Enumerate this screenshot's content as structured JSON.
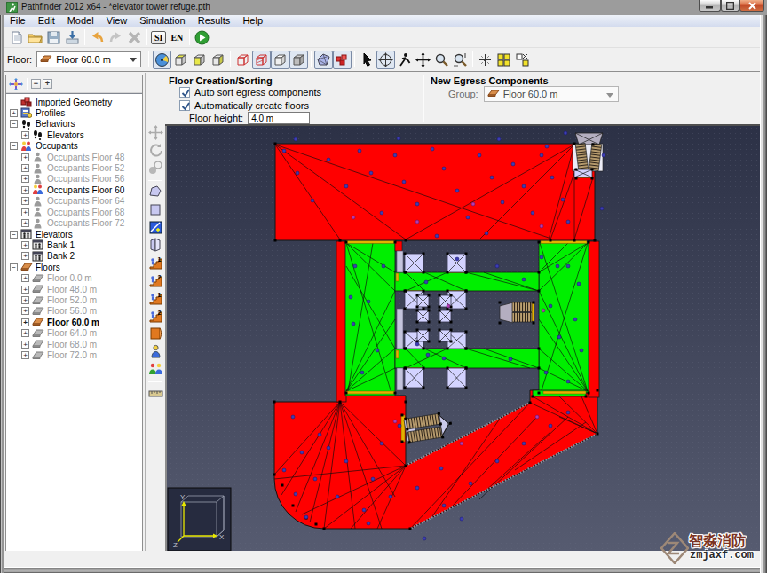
{
  "window": {
    "title": "Pathfinder 2012 x64 - *elevator tower refuge.pth",
    "buttons": [
      "minimize",
      "maximize",
      "close"
    ]
  },
  "menu": {
    "items": [
      "File",
      "Edit",
      "Model",
      "View",
      "Simulation",
      "Results",
      "Help"
    ]
  },
  "toolbar_main": {
    "items": [
      {
        "icon": "new-document"
      },
      {
        "icon": "open-folder"
      },
      {
        "icon": "save"
      },
      {
        "icon": "import"
      },
      {
        "sep": true
      },
      {
        "icon": "undo"
      },
      {
        "icon": "redo",
        "disabled": true
      },
      {
        "icon": "delete-x",
        "disabled": true
      },
      {
        "sep": true
      },
      {
        "icon": "si-units",
        "label": "SI",
        "boxed": true
      },
      {
        "icon": "en-language",
        "label": "EN"
      },
      {
        "sep": true
      },
      {
        "icon": "run-simulation"
      }
    ]
  },
  "floor_bar": {
    "label": "Floor:",
    "value": "Floor 60.0 m"
  },
  "view_toolbar": {
    "items": [
      {
        "icon": "perspective-view",
        "pressed": true
      },
      {
        "icon": "cube-top-view"
      },
      {
        "icon": "cube-front-view"
      },
      {
        "icon": "cube-side-view"
      },
      {
        "sep": true
      },
      {
        "icon": "wire-cube"
      },
      {
        "icon": "hatch-cube",
        "pressed": true
      },
      {
        "icon": "solid-cube",
        "pressed": true
      },
      {
        "icon": "gray-cube",
        "pressed": true
      },
      {
        "sep": true
      },
      {
        "icon": "show-navmesh",
        "pressed": true
      },
      {
        "icon": "show-results",
        "pressed": true
      },
      {
        "sep": true
      },
      {
        "icon": "select-arrow"
      },
      {
        "icon": "orbit-tool",
        "pressed": true
      },
      {
        "icon": "runner"
      },
      {
        "icon": "pan-tool"
      },
      {
        "icon": "zoom-tool"
      },
      {
        "icon": "zoom-box-tool"
      },
      {
        "sep": true
      },
      {
        "icon": "center-view"
      },
      {
        "icon": "view-all"
      },
      {
        "icon": "view-selection"
      }
    ]
  },
  "draw_toolbar": {
    "items": [
      {
        "icon": "move-tool",
        "disabled": true
      },
      {
        "icon": "rotate-tool",
        "disabled": true
      },
      {
        "icon": "scale-tool",
        "disabled": true
      },
      {
        "sep": true
      },
      {
        "icon": "polygon-room-tool"
      },
      {
        "icon": "rectangle-room-tool"
      },
      {
        "icon": "thin-room-tool"
      },
      {
        "icon": "door-tool"
      },
      {
        "icon": "stairs-up-tool",
        "badge": "1"
      },
      {
        "icon": "stairs-down-tool",
        "badge": "2"
      },
      {
        "icon": "ramp-up-tool",
        "badge": "1"
      },
      {
        "icon": "ramp-down-tool",
        "badge": "2"
      },
      {
        "icon": "doorway-tool"
      },
      {
        "icon": "occupant-tool"
      },
      {
        "icon": "occupant-group-tool"
      },
      {
        "sep": true
      },
      {
        "icon": "measure-tool"
      }
    ]
  },
  "tree_header": {
    "icons": [
      "refresh-colors",
      "collapse-all",
      "expand-all"
    ]
  },
  "tree": {
    "items": [
      {
        "label": "Imported Geometry",
        "icon": "geometry",
        "depth": 0,
        "exp": "none"
      },
      {
        "label": "Profiles",
        "icon": "profiles",
        "depth": 0,
        "exp": "plus"
      },
      {
        "label": "Behaviors",
        "icon": "footprints",
        "depth": 0,
        "exp": "minus"
      },
      {
        "label": "Elevators",
        "icon": "footprints",
        "depth": 1,
        "exp": "plus"
      },
      {
        "label": "Occupants",
        "icon": "occupants-color",
        "depth": 0,
        "exp": "minus"
      },
      {
        "label": "Occupants Floor 48",
        "icon": "occupant-gray",
        "depth": 1,
        "exp": "plus",
        "gray": true
      },
      {
        "label": "Occupants Floor 52",
        "icon": "occupant-gray",
        "depth": 1,
        "exp": "plus",
        "gray": true
      },
      {
        "label": "Occupants Floor 56",
        "icon": "occupant-gray",
        "depth": 1,
        "exp": "plus",
        "gray": true
      },
      {
        "label": "Occupants Floor 60",
        "icon": "occupants-color",
        "depth": 1,
        "exp": "plus"
      },
      {
        "label": "Occupants Floor 64",
        "icon": "occupant-gray",
        "depth": 1,
        "exp": "plus",
        "gray": true
      },
      {
        "label": "Occupants Floor 68",
        "icon": "occupant-gray",
        "depth": 1,
        "exp": "plus",
        "gray": true
      },
      {
        "label": "Occupants Floor 72",
        "icon": "occupant-gray",
        "depth": 1,
        "exp": "plus",
        "gray": true
      },
      {
        "label": "Elevators",
        "icon": "elevator",
        "depth": 0,
        "exp": "minus"
      },
      {
        "label": "Bank 1",
        "icon": "elevator",
        "depth": 1,
        "exp": "plus"
      },
      {
        "label": "Bank 2",
        "icon": "elevator",
        "depth": 1,
        "exp": "plus"
      },
      {
        "label": "Floors",
        "icon": "floor-orange",
        "depth": 0,
        "exp": "minus"
      },
      {
        "label": "Floor 0.0 m",
        "icon": "floor-gray",
        "depth": 1,
        "exp": "plus",
        "gray": true
      },
      {
        "label": "Floor 48.0 m",
        "icon": "floor-gray",
        "depth": 1,
        "exp": "plus",
        "gray": true
      },
      {
        "label": "Floor 52.0 m",
        "icon": "floor-gray",
        "depth": 1,
        "exp": "plus",
        "gray": true
      },
      {
        "label": "Floor 56.0 m",
        "icon": "floor-gray",
        "depth": 1,
        "exp": "plus",
        "gray": true
      },
      {
        "label": "Floor 60.0 m",
        "icon": "floor-orange",
        "depth": 1,
        "exp": "plus",
        "bold": true
      },
      {
        "label": "Floor 64.0 m",
        "icon": "floor-gray",
        "depth": 1,
        "exp": "plus",
        "gray": true
      },
      {
        "label": "Floor 68.0 m",
        "icon": "floor-gray",
        "depth": 1,
        "exp": "plus",
        "gray": true
      },
      {
        "label": "Floor 72.0 m",
        "icon": "floor-gray",
        "depth": 1,
        "exp": "plus",
        "gray": true
      }
    ]
  },
  "options_panel": {
    "floor_creation": {
      "title": "Floor Creation/Sorting",
      "checkbox1": {
        "label": "Auto sort egress components",
        "checked": true
      },
      "checkbox2": {
        "label": "Automatically create floors",
        "checked": true
      },
      "floor_height_label": "Floor height:",
      "floor_height_value": "4.0 m"
    },
    "new_egress": {
      "title": "New Egress Components",
      "group_label": "Group:",
      "group_value": "Floor 60.0 m"
    }
  },
  "canvas": {
    "colors": {
      "bg_top": "#2c3146",
      "bg_bottom": "#565b70",
      "room": "#ff0000",
      "exit_room": "#00ef00",
      "shaft": "#d3d3ff",
      "door": "#e4b100",
      "stair": "#bb9f70",
      "occupant": "#3d3db4",
      "occupant_alt": "#b23cb2"
    },
    "axis_labels": {
      "x": "X",
      "y": "Y",
      "z": "Z"
    }
  },
  "watermark": {
    "line1": "智淼消防",
    "line2": "zmjaxf.com"
  }
}
